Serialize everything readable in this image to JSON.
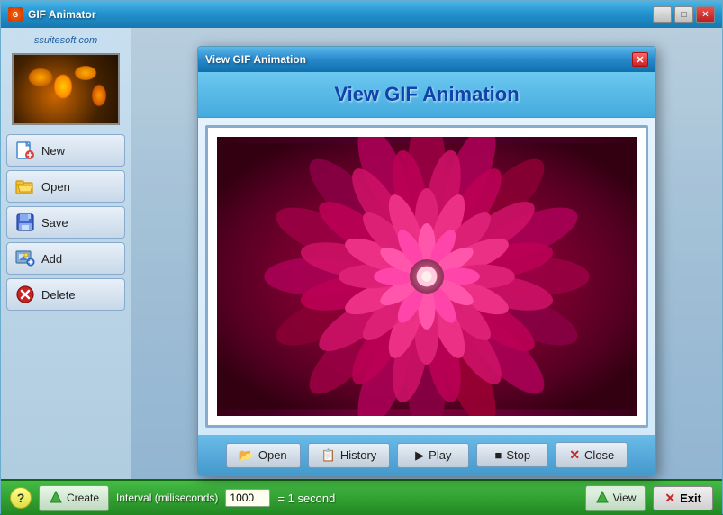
{
  "app": {
    "title": "GIF Animator",
    "site_label": "ssuitesoft.com"
  },
  "title_bar": {
    "minimize_label": "−",
    "maximize_label": "□",
    "close_label": "✕"
  },
  "sidebar": {
    "buttons": [
      {
        "id": "new",
        "label": "New",
        "icon": "🎨"
      },
      {
        "id": "open",
        "label": "Open",
        "icon": "📂"
      },
      {
        "id": "save",
        "label": "Save",
        "icon": "💾"
      },
      {
        "id": "add",
        "label": "Add",
        "icon": "🖼️"
      },
      {
        "id": "delete",
        "label": "Delete",
        "icon": "❌"
      }
    ]
  },
  "bottom_bar": {
    "help_label": "?",
    "create_label": "Create",
    "interval_label": "Interval (miliseconds)",
    "interval_value": "1000",
    "equal_label": "= 1 second",
    "view_label": "View",
    "exit_label": "Exit"
  },
  "modal": {
    "title": "View GIF Animation",
    "header_title": "View GIF Animation",
    "close_label": "✕",
    "buttons": [
      {
        "id": "open",
        "label": "Open",
        "icon": "📂"
      },
      {
        "id": "history",
        "label": "History",
        "icon": "📋"
      },
      {
        "id": "play",
        "label": "Play",
        "icon": "▶"
      },
      {
        "id": "stop",
        "label": "Stop",
        "icon": "■"
      },
      {
        "id": "close",
        "label": "Close",
        "icon": "✕"
      }
    ]
  }
}
